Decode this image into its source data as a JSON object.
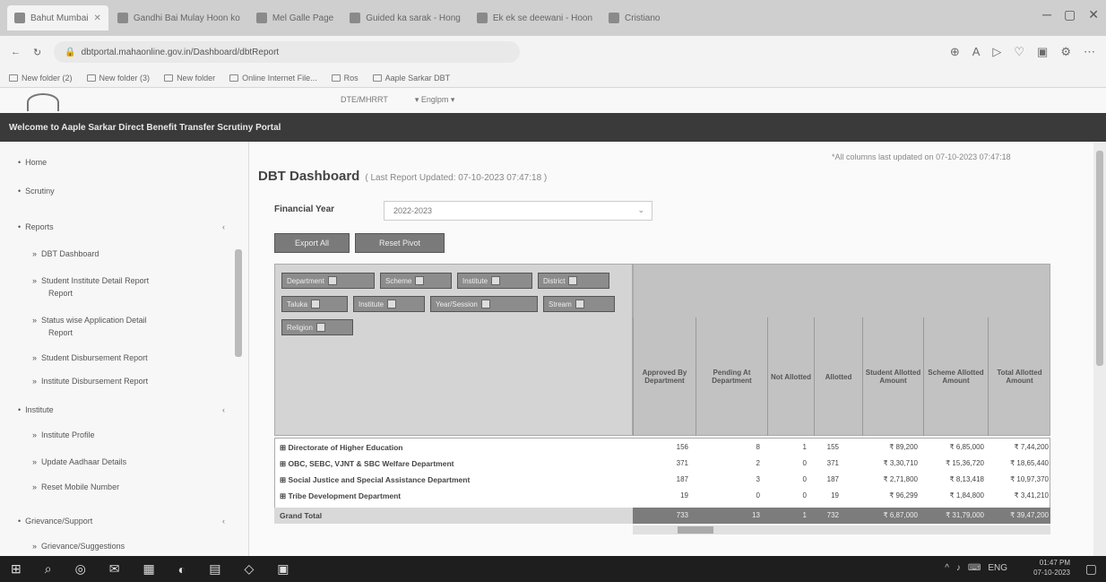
{
  "browser": {
    "tabs": [
      {
        "label": "Bahut Mumbai"
      },
      {
        "label": "Gandhi Bai Mulay Hoon ko"
      },
      {
        "label": "Mel Galle Page"
      },
      {
        "label": "Guided ka sarak - Hong"
      },
      {
        "label": "Ek ek se deewani - Hoon"
      },
      {
        "label": "Cristiano"
      }
    ],
    "url": "dbtportal.mahaonline.gov.in/Dashboard/dbtReport",
    "bookmarks": [
      "New folder (2)",
      "New folder (3)",
      "New folder",
      "Online Internet File...",
      "Ros",
      "Aaple Sarkar DBT"
    ],
    "window_controls": [
      "─",
      "▢",
      "✕"
    ]
  },
  "site": {
    "banner": "Welcome to Aaple Sarkar Direct Benefit Transfer Scrutiny Portal",
    "lang_select": [
      "DTE/MHRRT",
      "▾ Englpm ▾"
    ]
  },
  "sidebar": {
    "items": [
      {
        "label": "Home",
        "marker": "•"
      },
      {
        "label": "Scrutiny",
        "marker": "•"
      },
      {
        "label": "Reports",
        "marker": "•",
        "chev": "‹"
      },
      {
        "label": "DBT Dashboard",
        "marker": "»"
      },
      {
        "label": "Student Institute Detail Report",
        "marker": "»"
      },
      {
        "label": "Report",
        "marker": ""
      },
      {
        "label": "Status wise Application Detail",
        "marker": "»"
      },
      {
        "label": "Report",
        "marker": ""
      },
      {
        "label": "Student Disbursement Report",
        "marker": "»"
      },
      {
        "label": "Institute Disbursement Report",
        "marker": "»"
      },
      {
        "label": "Institute",
        "marker": "•",
        "chev": "‹"
      },
      {
        "label": "Institute Profile",
        "marker": "»"
      },
      {
        "label": "Update Aadhaar Details",
        "marker": "»"
      },
      {
        "label": "Reset Mobile Number",
        "marker": "»"
      },
      {
        "label": "Grievance/Support",
        "marker": "•",
        "chev": "‹"
      },
      {
        "label": "Grievance/Suggestions",
        "marker": "»"
      }
    ]
  },
  "main": {
    "title": "DBT Dashboard",
    "subtitle": "( Last Report Updated: 07-10-2023 07:47:18 )",
    "notice": "*All columns last updated on 07-10-2023 07:47:18",
    "financial_year_label": "Financial Year",
    "financial_year_value": "2022-2023",
    "buttons": {
      "export": "Export All",
      "reset": "Reset Pivot"
    },
    "filter_chips": [
      "Department",
      "Scheme",
      "Institute",
      "District",
      "Taluka",
      "Institute",
      "Year/Session",
      "Stream",
      "Religion"
    ],
    "columns": [
      "Approved By Department",
      "Pending At Department",
      "Not Allotted",
      "Allotted",
      "Student Allotted Amount",
      "Scheme Allotted Amount",
      "Total Allotted Amount"
    ],
    "rows": [
      {
        "name": "Directorate of Higher Education",
        "values": [
          "156",
          "8",
          "1",
          "155",
          "₹ 89,200",
          "₹ 6,85,000",
          "₹ 7,44,200"
        ]
      },
      {
        "name": "OBC, SEBC, VJNT & SBC Welfare Department",
        "values": [
          "371",
          "2",
          "0",
          "371",
          "₹ 3,30,710",
          "₹ 15,36,720",
          "₹ 18,65,440"
        ]
      },
      {
        "name": "Social Justice and Special Assistance Department",
        "values": [
          "187",
          "3",
          "0",
          "187",
          "₹ 2,71,800",
          "₹ 8,13,418",
          "₹ 10,97,370"
        ]
      },
      {
        "name": "Tribe Development Department",
        "values": [
          "19",
          "0",
          "0",
          "19",
          "₹ 96,299",
          "₹ 1,84,800",
          "₹ 3,41,210"
        ]
      }
    ],
    "total_label": "Grand Total",
    "total_values": [
      "733",
      "13",
      "1",
      "732",
      "₹ 6,87,000",
      "₹ 31,79,000",
      "₹ 39,47,200"
    ]
  },
  "taskbar": {
    "icons": [
      "windows-logo",
      "search",
      "task-view",
      "mail",
      "calculator",
      "edge",
      "file-explorer",
      "store",
      "photos"
    ],
    "tray": [
      "^",
      "♪",
      "⌨",
      "ENG"
    ],
    "time": "01:47 PM",
    "date": "07-10-2023"
  }
}
